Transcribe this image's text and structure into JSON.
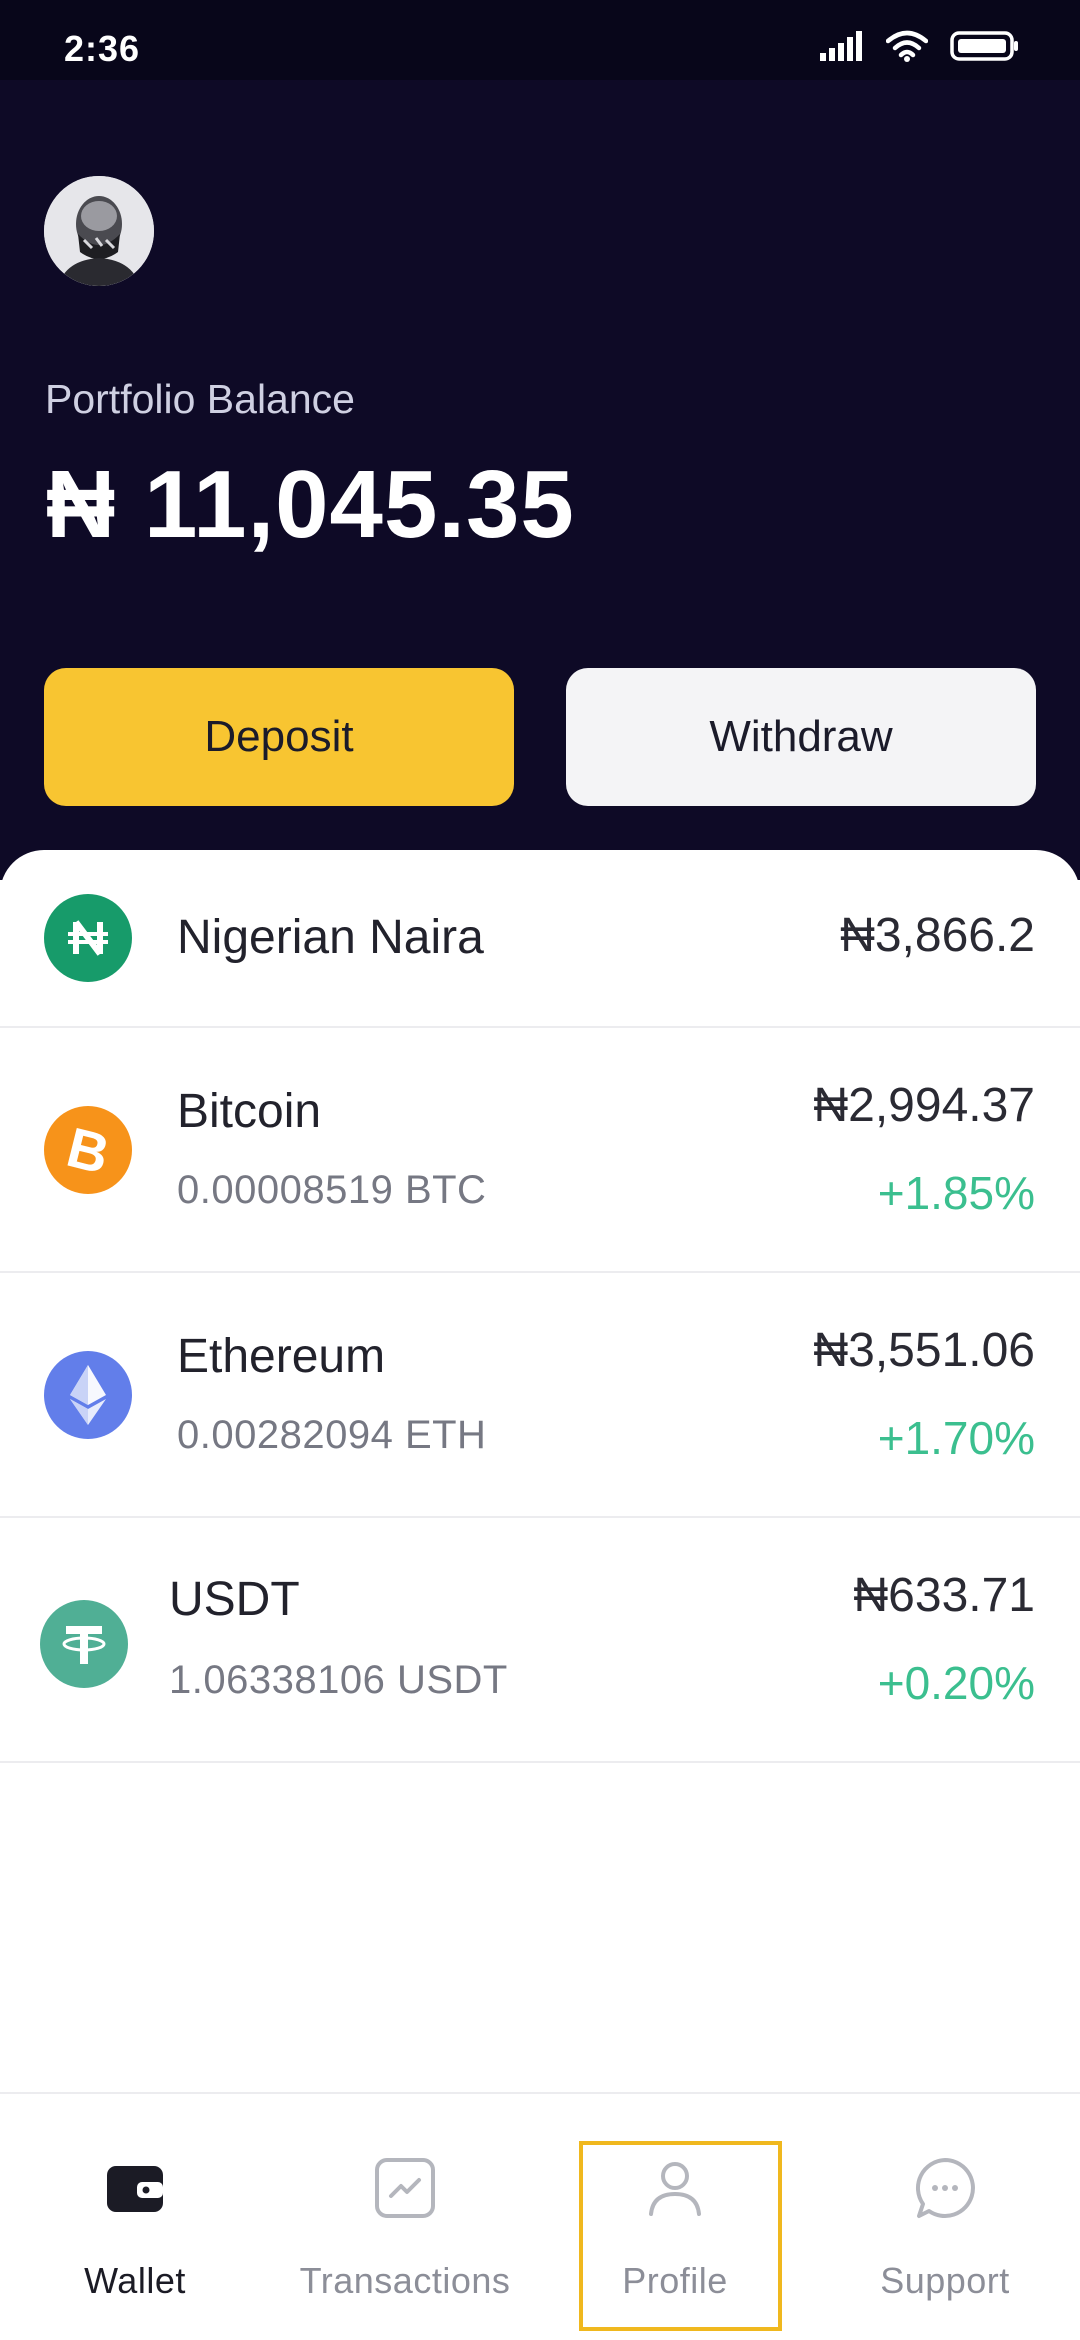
{
  "status_bar": {
    "time": "2:36",
    "icons": [
      "signal-icon",
      "wifi-icon",
      "battery-icon"
    ]
  },
  "header": {
    "avatar": "profile-photo",
    "balance_label": "Portfolio Balance",
    "balance_value": "₦ 11,045.35"
  },
  "actions": {
    "deposit_label": "Deposit",
    "withdraw_label": "Withdraw"
  },
  "assets": [
    {
      "name": "Nigerian Naira",
      "amount": "",
      "price": "₦3,866.2",
      "change": "",
      "icon": "naira-icon",
      "color": "#179b6a"
    },
    {
      "name": "Bitcoin",
      "amount": "0.00008519 BTC",
      "price": "₦2,994.37",
      "change": "+1.85%",
      "icon": "bitcoin-icon",
      "color": "#f7931a"
    },
    {
      "name": "Ethereum",
      "amount": "0.00282094 ETH",
      "price": "₦3,551.06",
      "change": "+1.70%",
      "icon": "ethereum-icon",
      "color": "#627eea"
    },
    {
      "name": "USDT",
      "amount": "1.06338106 USDT",
      "price": "₦633.71",
      "change": "+0.20%",
      "icon": "tether-icon",
      "color": "#50af95"
    }
  ],
  "nav": [
    {
      "label": "Wallet",
      "icon": "wallet-icon",
      "active": true
    },
    {
      "label": "Transactions",
      "icon": "chart-icon",
      "active": false
    },
    {
      "label": "Profile",
      "icon": "user-icon",
      "active": false,
      "highlighted": true
    },
    {
      "label": "Support",
      "icon": "chat-icon",
      "active": false
    }
  ],
  "colors": {
    "header_bg": "#0e0a26",
    "deposit": "#f8c531",
    "withdraw": "#f4f4f6",
    "positive": "#3bbf8f",
    "highlight": "#f0b81e"
  }
}
